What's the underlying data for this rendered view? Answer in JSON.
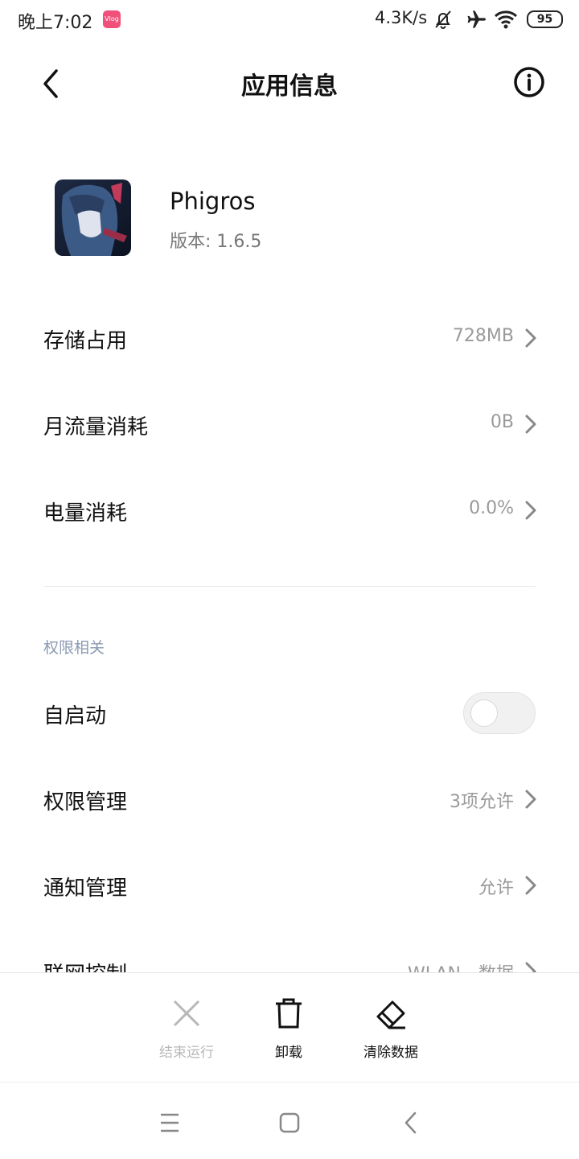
{
  "status_bar": {
    "time": "晚上7:02",
    "app_badge": "Vlog",
    "net_speed": "4.3K/s",
    "battery": "95"
  },
  "header": {
    "title": "应用信息"
  },
  "app": {
    "name": "Phigros",
    "version": "版本: 1.6.5"
  },
  "usage": [
    {
      "label": "存储占用",
      "value": "728MB"
    },
    {
      "label": "月流量消耗",
      "value": "0B"
    },
    {
      "label": "电量消耗",
      "value": "0.0%"
    }
  ],
  "permissions_section": {
    "title": "权限相关",
    "autostart_label": "自启动",
    "autostart_enabled": false,
    "items": [
      {
        "label": "权限管理",
        "value": "3项允许"
      },
      {
        "label": "通知管理",
        "value": "允许"
      },
      {
        "label": "联网控制",
        "value": "WLAN、数据"
      }
    ]
  },
  "actions": [
    {
      "label": "结束运行",
      "enabled": false
    },
    {
      "label": "卸载",
      "enabled": true
    },
    {
      "label": "清除数据",
      "enabled": true
    }
  ],
  "colors": {
    "text_primary": "#111111",
    "text_secondary": "#9a9a9a",
    "section_header": "#8a9ab3",
    "disabled": "#b8b8b8"
  }
}
